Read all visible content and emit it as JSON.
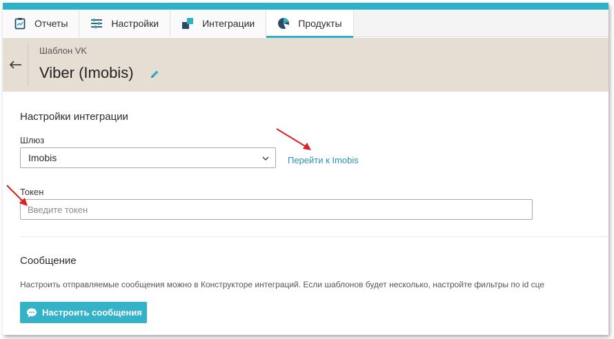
{
  "tabs": [
    {
      "label": "Отчеты",
      "icon": "clipboard-chart-icon"
    },
    {
      "label": "Настройки",
      "icon": "sliders-icon"
    },
    {
      "label": "Интеграции",
      "icon": "integration-blocks-icon"
    },
    {
      "label": "Продукты",
      "icon": "products-pie-icon",
      "active": true
    }
  ],
  "header": {
    "breadcrumb": "Шаблон VK",
    "title": "Viber (Imobis)"
  },
  "integration": {
    "section_title": "Настройки интеграции",
    "gateway_label": "Шлюз",
    "gateway_value": "Imobis",
    "gateway_link": "Перейти к Imobis",
    "token_label": "Токен",
    "token_placeholder": "Введите токен"
  },
  "message": {
    "section_title": "Сообщение",
    "description": "Настроить отправляемые сообщения можно в Конструкторе интеграций. Если шаблонов будет несколько, настройте фильтры по id сце",
    "button_label": "Настроить сообщения"
  },
  "colors": {
    "accent": "#2fb0c7",
    "header_bg": "#e6ddd3",
    "link": "#2a8fb0",
    "annotation_arrow": "#e02020"
  }
}
